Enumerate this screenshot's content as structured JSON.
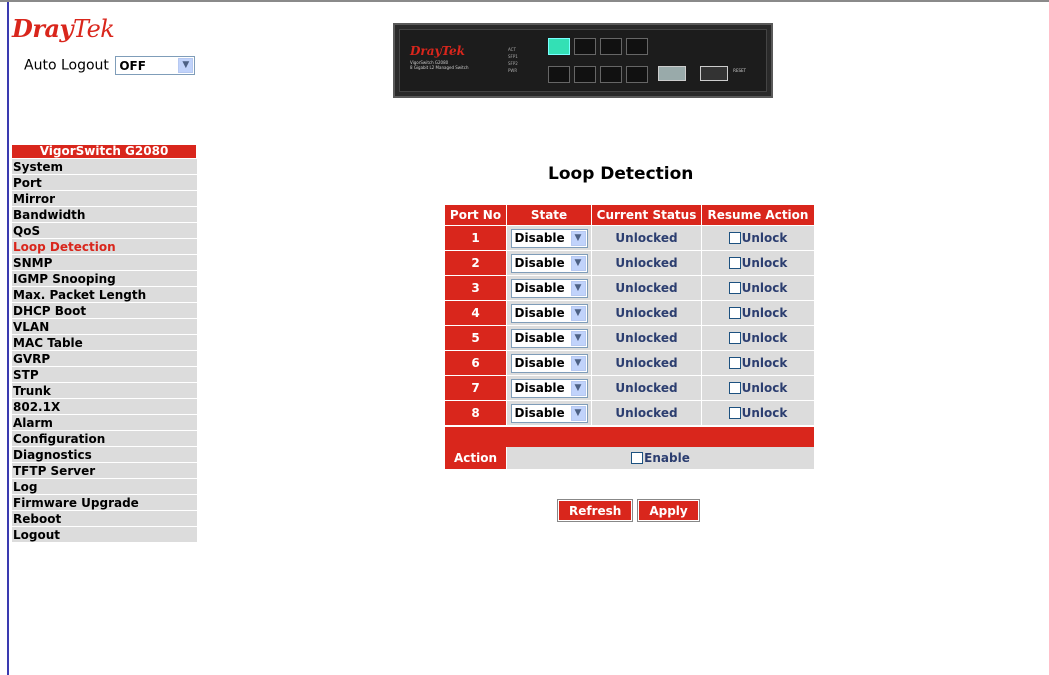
{
  "brand": {
    "name_a": "Dray",
    "name_b": "Tek",
    "accent": "#d9261c"
  },
  "auto_logout": {
    "label": "Auto Logout",
    "value": "OFF"
  },
  "device_panel": {
    "logo": "DrayTek",
    "model_text": "VigorSwitch G2080",
    "subtitle": "8 Gigabit L2 Managed Switch",
    "led_labels": [
      "ACT",
      "SFP1",
      "SFP2",
      "PWR"
    ],
    "reset_label": "RESET"
  },
  "menu": {
    "header": "VigorSwitch G2080",
    "active": "Loop Detection",
    "items": [
      "System",
      "Port",
      "Mirror",
      "Bandwidth",
      "QoS",
      "Loop Detection",
      "SNMP",
      "IGMP Snooping",
      "Max. Packet Length",
      "DHCP Boot",
      "VLAN",
      "MAC Table",
      "GVRP",
      "STP",
      "Trunk",
      "802.1X",
      "Alarm",
      "Configuration",
      "Diagnostics",
      "TFTP Server",
      "Log",
      "Firmware Upgrade",
      "Reboot",
      "Logout"
    ]
  },
  "page": {
    "title": "Loop Detection"
  },
  "table": {
    "headers": [
      "Port No",
      "State",
      "Current Status",
      "Resume Action"
    ],
    "rows": [
      {
        "port": "1",
        "state": "Disable",
        "status": "Unlocked",
        "resume": "Unlock"
      },
      {
        "port": "2",
        "state": "Disable",
        "status": "Unlocked",
        "resume": "Unlock"
      },
      {
        "port": "3",
        "state": "Disable",
        "status": "Unlocked",
        "resume": "Unlock"
      },
      {
        "port": "4",
        "state": "Disable",
        "status": "Unlocked",
        "resume": "Unlock"
      },
      {
        "port": "5",
        "state": "Disable",
        "status": "Unlocked",
        "resume": "Unlock"
      },
      {
        "port": "6",
        "state": "Disable",
        "status": "Unlocked",
        "resume": "Unlock"
      },
      {
        "port": "7",
        "state": "Disable",
        "status": "Unlocked",
        "resume": "Unlock"
      },
      {
        "port": "8",
        "state": "Disable",
        "status": "Unlocked",
        "resume": "Unlock"
      }
    ],
    "action_label": "Action",
    "action_checkbox": "Enable"
  },
  "buttons": {
    "refresh": "Refresh",
    "apply": "Apply"
  },
  "icons": {
    "select_arrow": "chevron-down-icon"
  }
}
